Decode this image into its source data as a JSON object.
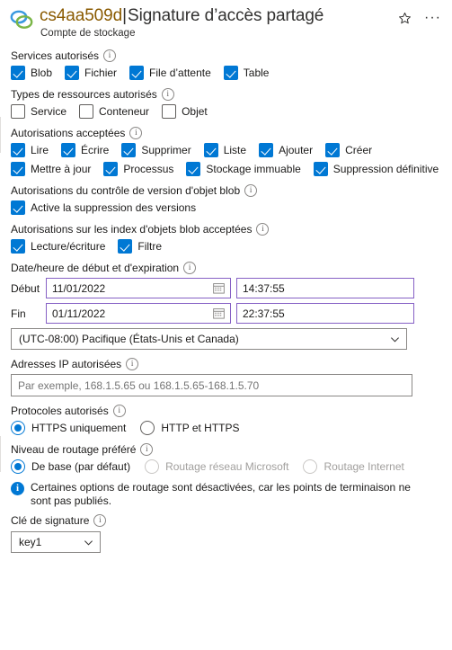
{
  "header": {
    "icon": "storage-account-rings-icon",
    "resource_name": "cs4aa509d",
    "separator": "|",
    "title": "Signature d’accès partagé",
    "subtitle": "Compte de stockage",
    "favorite_icon": "star-outline-icon",
    "more_icon": "ellipsis-icon"
  },
  "services": {
    "label": "Services autorisés",
    "items": [
      {
        "label": "Blob",
        "checked": true
      },
      {
        "label": "Fichier",
        "checked": true
      },
      {
        "label": "File d’attente",
        "checked": true
      },
      {
        "label": "Table",
        "checked": true
      }
    ]
  },
  "resource_types": {
    "label": "Types de ressources autorisés",
    "items": [
      {
        "label": "Service",
        "checked": false
      },
      {
        "label": "Conteneur",
        "checked": false
      },
      {
        "label": "Objet",
        "checked": false
      }
    ]
  },
  "permissions": {
    "label": "Autorisations acceptées",
    "row1": [
      {
        "label": "Lire",
        "checked": true
      },
      {
        "label": "Écrire",
        "checked": true
      },
      {
        "label": "Supprimer",
        "checked": true
      },
      {
        "label": "Liste",
        "checked": true
      },
      {
        "label": "Ajouter",
        "checked": true
      },
      {
        "label": "Créer",
        "checked": true
      }
    ],
    "row2": [
      {
        "label": "Mettre à jour",
        "checked": true
      },
      {
        "label": "Processus",
        "checked": true
      },
      {
        "label": "Stockage immuable",
        "checked": true
      },
      {
        "label": "Suppression définitive",
        "checked": true
      }
    ]
  },
  "blob_versioning": {
    "label": "Autorisations du contrôle de version d'objet blob",
    "items": [
      {
        "label": "Active la suppression des versions",
        "checked": true
      }
    ]
  },
  "blob_index": {
    "label": "Autorisations sur les index d'objets blob acceptées",
    "items": [
      {
        "label": "Lecture/écriture",
        "checked": true
      },
      {
        "label": "Filtre",
        "checked": true
      }
    ]
  },
  "datetime": {
    "label": "Date/heure de début et d'expiration",
    "start_caption": "Début",
    "start_date": "11/01/2022",
    "start_time": "14:37:55",
    "end_caption": "Fin",
    "end_date": "01/11/2022",
    "end_time": "22:37:55",
    "timezone": "(UTC-08:00) Pacifique (États-Unis et Canada)",
    "calendar_icon": "calendar-icon",
    "chevron_icon": "chevron-down-icon"
  },
  "allowed_ip": {
    "label": "Adresses IP autorisées",
    "value": "",
    "placeholder": "Par exemple, 168.1.5.65 ou 168.1.5.65-168.1.5.70"
  },
  "protocols": {
    "label": "Protocoles autorisés",
    "options": [
      {
        "label": "HTTPS uniquement",
        "selected": true,
        "disabled": false
      },
      {
        "label": "HTTP et HTTPS",
        "selected": false,
        "disabled": false
      }
    ]
  },
  "routing": {
    "label": "Niveau de routage préféré",
    "options": [
      {
        "label": "De base (par défaut)",
        "selected": true,
        "disabled": false
      },
      {
        "label": "Routage réseau Microsoft",
        "selected": false,
        "disabled": true
      },
      {
        "label": "Routage Internet",
        "selected": false,
        "disabled": true
      }
    ],
    "notice": "Certaines options de routage sont désactivées, car les points de terminaison ne sont pas publiés.",
    "notice_icon": "info-filled-icon"
  },
  "signing_key": {
    "label": "Clé de signature",
    "value": "key1"
  },
  "colors": {
    "accent": "#0078d4",
    "date_border": "#8661c5",
    "resource_name": "#8a5a00",
    "disabled_text": "#a19f9d"
  }
}
